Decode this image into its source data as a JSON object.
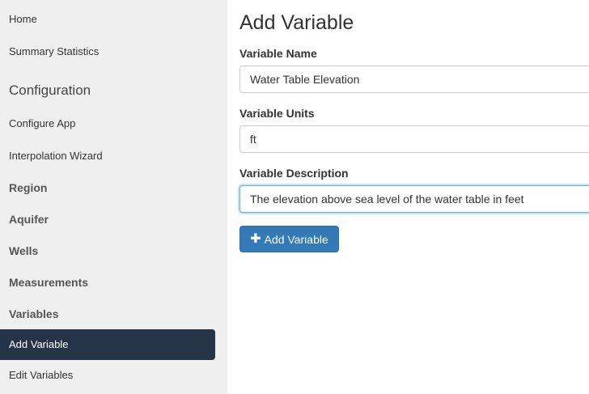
{
  "sidebar": {
    "links_top": [
      {
        "label": "Home"
      },
      {
        "label": "Summary Statistics"
      }
    ],
    "config_header": "Configuration",
    "config_links": [
      {
        "label": "Configure App"
      },
      {
        "label": "Interpolation Wizard"
      }
    ],
    "sections": [
      {
        "label": "Region"
      },
      {
        "label": "Aquifer"
      },
      {
        "label": "Wells"
      },
      {
        "label": "Measurements"
      },
      {
        "label": "Variables"
      }
    ],
    "active_item": "Add Variable",
    "edit_item": "Edit Variables"
  },
  "main": {
    "title": "Add Variable",
    "fields": {
      "name": {
        "label": "Variable Name",
        "value": "Water Table Elevation"
      },
      "units": {
        "label": "Variable Units",
        "value": "ft"
      },
      "description": {
        "label": "Variable Description",
        "value": "The elevation above sea level of the water table in feet"
      }
    },
    "submit_button": {
      "icon": "plus-icon",
      "label": "Add Variable"
    }
  },
  "colors": {
    "sidebar_bg": "#efefef",
    "active_bg": "#263447",
    "primary_button": "#337ab7",
    "focus_border": "#66afe9"
  }
}
